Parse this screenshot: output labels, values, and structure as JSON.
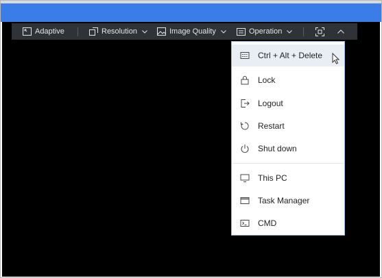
{
  "toolbar": {
    "adaptive_label": "Adaptive",
    "resolution_label": "Resolution",
    "image_quality_label": "Image Quality",
    "operation_label": "Operation"
  },
  "operation_menu": {
    "group1": {
      "ctrl_alt_delete": "Ctrl + Alt + Delete",
      "lock": "Lock",
      "logout": "Logout",
      "restart": "Restart",
      "shut_down": "Shut down"
    },
    "group2": {
      "this_pc": "This PC",
      "task_manager": "Task Manager",
      "cmd": "CMD"
    }
  },
  "colors": {
    "title_bar": "#3b7de8",
    "toolbar_bg": "#2f3237",
    "screen_bg": "#000000",
    "menu_highlight": "#e9eef5"
  }
}
